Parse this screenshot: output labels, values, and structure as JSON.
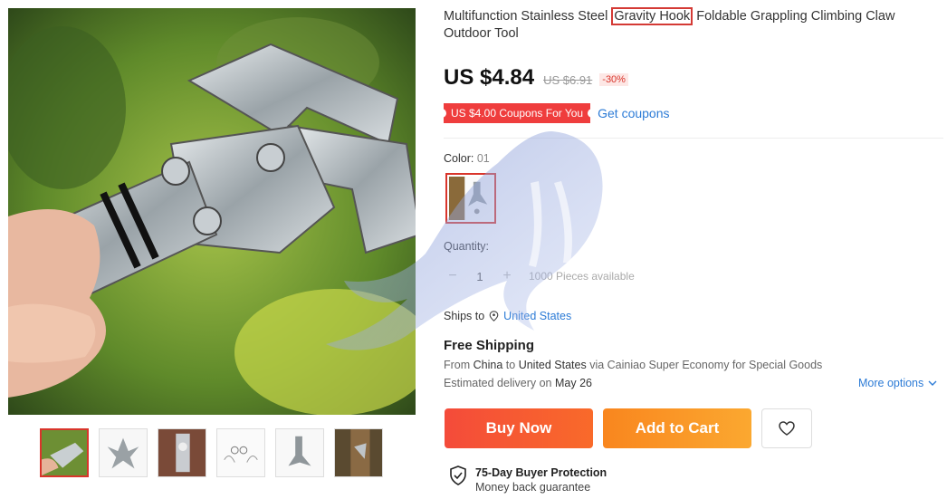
{
  "product": {
    "title_before": "Multifunction Stainless Steel ",
    "title_highlight": "Gravity Hook",
    "title_after": " Foldable Grappling Climbing Claw Outdoor Tool"
  },
  "pricing": {
    "price": "US $4.84",
    "original_price": "US $6.91",
    "discount": "-30%"
  },
  "coupon": {
    "badge": "US $4.00 Coupons For You",
    "link": "Get coupons"
  },
  "color": {
    "label": "Color:",
    "value": "01"
  },
  "quantity": {
    "label": "Quantity:",
    "minus": "−",
    "value": "1",
    "plus": "+",
    "available": "1000 Pieces available"
  },
  "shipping": {
    "ships_to_label": "Ships to",
    "destination": "United States",
    "title": "Free Shipping",
    "from_prefix": "From ",
    "origin": "China",
    "to_word": " to ",
    "to_country": "United States",
    "via_text": " via Cainiao Super Economy for Special Goods",
    "est_prefix": "Estimated delivery on ",
    "est_date": "May 26",
    "more_options": "More options"
  },
  "actions": {
    "buy_now": "Buy Now",
    "add_to_cart": "Add to Cart"
  },
  "protection": {
    "title": "75-Day Buyer Protection",
    "subtitle": "Money back guarantee"
  },
  "icons": {
    "location": "location-pin-icon",
    "wishlist": "heart-icon",
    "shield": "shield-check-icon",
    "chevron": "chevron-down-icon"
  },
  "colors": {
    "price_red": "#d9352b",
    "link_blue": "#2c7bd6",
    "buy_now": "#f44b3a",
    "add_to_cart": "#f9861e",
    "coupon_red": "#ef3d3d"
  }
}
